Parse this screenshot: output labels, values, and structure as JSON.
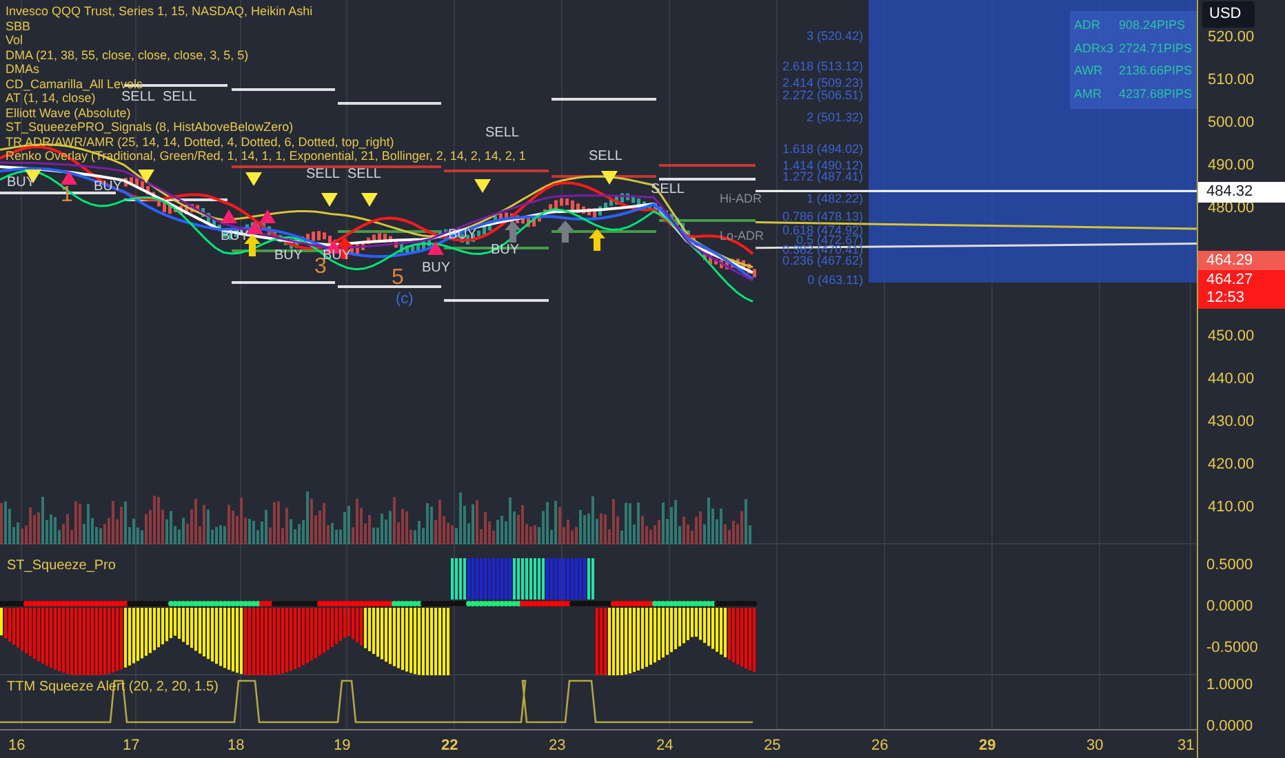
{
  "legend": [
    "Invesco QQQ Trust, Series 1, 15, NASDAQ, Heikin Ashi",
    "SBB",
    "Vol",
    "DMA (21, 38, 55, close, close, close, 3, 5, 5)",
    "DMAs",
    "CD_Camarilla_All Levels",
    "AT (1, 14, close)",
    "Elliott Wave (Absolute)",
    "ST_SqueezePRO_Signals (8, HistAboveBelowZero)",
    "TR ADR/AWR/AMR (25, 14, 14, Dotted, 4, Dotted, 6, Dotted, top_right)",
    "Renko Overlay (Traditional, Green/Red, 1, 14, 1, 1, Exponential, 21, Bollinger, 2, 14, 2, 14, 2, 1"
  ],
  "signals": [
    {
      "text": "BUY",
      "kind": "buy"
    },
    {
      "text": "1",
      "kind": "wave"
    },
    {
      "text": "BUY",
      "kind": "buy"
    },
    {
      "text": "SELL",
      "kind": "sell"
    },
    {
      "text": "SELL",
      "kind": "sell"
    },
    {
      "text": "BUY",
      "kind": "buy"
    },
    {
      "text": "BUY",
      "kind": "buy"
    },
    {
      "text": "SELL",
      "kind": "sell"
    },
    {
      "text": "3",
      "kind": "wave"
    },
    {
      "text": "BUY",
      "kind": "buy"
    },
    {
      "text": "SELL",
      "kind": "sell"
    },
    {
      "text": "5",
      "kind": "wave"
    },
    {
      "text": "(c)",
      "kind": "wave_sub"
    },
    {
      "text": "BUY",
      "kind": "buy"
    },
    {
      "text": "BUY",
      "kind": "buy"
    },
    {
      "text": "SELL",
      "kind": "sell"
    },
    {
      "text": "BUY",
      "kind": "buy"
    },
    {
      "text": "SELL",
      "kind": "sell"
    },
    {
      "text": "SELL",
      "kind": "sell"
    }
  ],
  "fib_levels": [
    "3 (520.42)",
    "2.618 (513.12)",
    "2.414 (509.23)",
    "2.272 (506.51)",
    "2 (501.32)",
    "1.618 (494.02)",
    "1.414 (490.12)",
    "1.272 (487.41)",
    "1 (482.22)",
    "0.786 (478.13)",
    "0.618 (474.92)",
    "0.5 (472.67)",
    "0.382 (470.41)",
    "0.236 (467.62)",
    "0 (463.11)"
  ],
  "range_labels": [
    "Hi-ADR",
    "Lo-ADR"
  ],
  "adr_table": [
    {
      "label": "ADR",
      "value": "908.24PIPS"
    },
    {
      "label": "ADRx3",
      "value": "2724.71PIPS"
    },
    {
      "label": "AWR",
      "value": "2136.66PIPS"
    },
    {
      "label": "AMR",
      "value": "4237.68PIPS"
    }
  ],
  "price_axis": {
    "currency": "USD",
    "ticks": [
      "520.00",
      "510.00",
      "500.00",
      "490.00",
      "480.00",
      "450.00",
      "440.00",
      "430.00",
      "420.00",
      "410.00"
    ],
    "tags": [
      {
        "text": "484.32",
        "kind": "level"
      },
      {
        "text": "464.29",
        "kind": "bid"
      },
      {
        "text": "464.27",
        "kind": "last",
        "countdown": "12:53"
      }
    ]
  },
  "squeeze_pane": {
    "title": "ST_Squeeze_Pro",
    "ticks": [
      "0.5000",
      "0.0000",
      "-0.5000"
    ]
  },
  "ttm_pane": {
    "title": "TTM Squeeze Alert (20, 2, 20, 1.5)",
    "ticks": [
      "1.0000",
      "0.0000"
    ]
  },
  "time_axis": [
    {
      "label": "16",
      "bold": false
    },
    {
      "label": "17",
      "bold": false
    },
    {
      "label": "18",
      "bold": false
    },
    {
      "label": "19",
      "bold": false
    },
    {
      "label": "22",
      "bold": true
    },
    {
      "label": "23",
      "bold": false
    },
    {
      "label": "24",
      "bold": false
    },
    {
      "label": "25",
      "bold": false
    },
    {
      "label": "26",
      "bold": false
    },
    {
      "label": "29",
      "bold": true
    },
    {
      "label": "30",
      "bold": false
    },
    {
      "label": "31",
      "bold": false
    }
  ]
}
